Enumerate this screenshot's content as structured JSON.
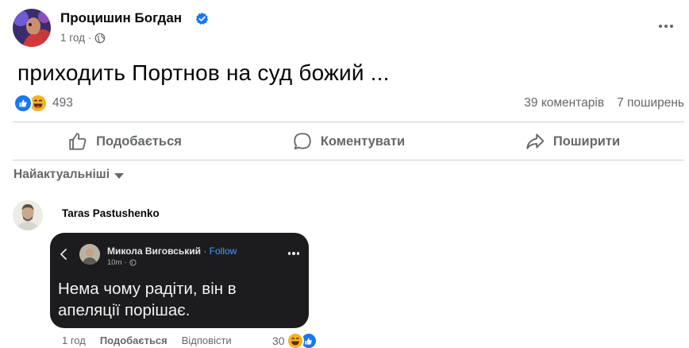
{
  "post": {
    "author": "Процишин Богдан",
    "time": "1 год",
    "privacy_icon": "globe-icon",
    "text": "приходить Портнов на суд божий ...",
    "reaction_count": "493",
    "comments": "39 коментарів",
    "shares": "7 поширень"
  },
  "actions": {
    "like": "Подобається",
    "comment": "Коментувати",
    "share": "Поширити"
  },
  "sort": {
    "label": "Найактуальніші"
  },
  "comment": {
    "author": "Taras Pastushenko",
    "time": "1 год",
    "like": "Подобається",
    "reply": "Відповісти",
    "reaction_count": "30",
    "image": {
      "name": "Микола Виговський",
      "separator": " · ",
      "follow": "Follow",
      "time": "10m",
      "text": "Нема чому радіти, він в апеляції порішає."
    }
  },
  "colors": {
    "accent": "#1877f2",
    "muted_text": "#65676b",
    "divider": "#ced0d4",
    "haha_yellow": "#f7b125",
    "image_bg": "#1c1c1e",
    "follow_blue": "#4599ff"
  }
}
